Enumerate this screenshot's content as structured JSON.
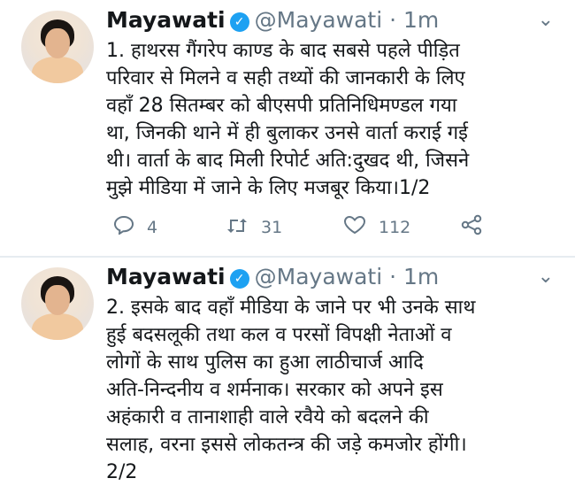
{
  "tweets": [
    {
      "name": "Mayawati",
      "handle": "@Mayawati",
      "time": "1m",
      "lines": [
        "1. हाथरस गैंगरेप काण्ड के बाद सबसे पहले पीड़ित",
        "परिवार से मिलने व सही तथ्यों की जानकारी के लिए",
        "वहाँ 28 सितम्बर को बीएसपी प्रतिनिधिमण्डल गया",
        "था, जिनकी थाने में ही बुलाकर उनसे वार्ता कराई गई",
        "थी। वार्ता के बाद मिली रिपोर्ट अति:दुखद थी, जिसने",
        "मुझे मीडिया में जाने के लिए मजबूर किया।1/2"
      ],
      "reply_count": "4",
      "retweet_count": "31",
      "like_count": "112"
    },
    {
      "name": "Mayawati",
      "handle": "@Mayawati",
      "time": "1m",
      "lines": [
        "2. इसके बाद वहाँ मीडिया के जाने पर भी उनके साथ",
        "हुई बदसलूकी तथा कल व परसों विपक्षी नेताओं व",
        "लोगों के साथ पुलिस का हुआ लाठीचार्ज आदि",
        "अति-निन्दनीय व शर्मनाक। सरकार को अपने इस",
        "अहंकारी व तानाशाही वाले रवैये को बदलने की",
        "सलाह, वरना इससे लोकतन्त्र की जड़े कमजोर होंगी।",
        "2/2"
      ]
    }
  ],
  "icons": {
    "verified": "verified-badge-icon",
    "caret": "chevron-down-icon",
    "reply": "reply-icon",
    "retweet": "retweet-icon",
    "like": "heart-icon",
    "share": "share-icon"
  },
  "colors": {
    "verified": "#1da1f2",
    "muted": "#657786",
    "text": "#14171a"
  }
}
